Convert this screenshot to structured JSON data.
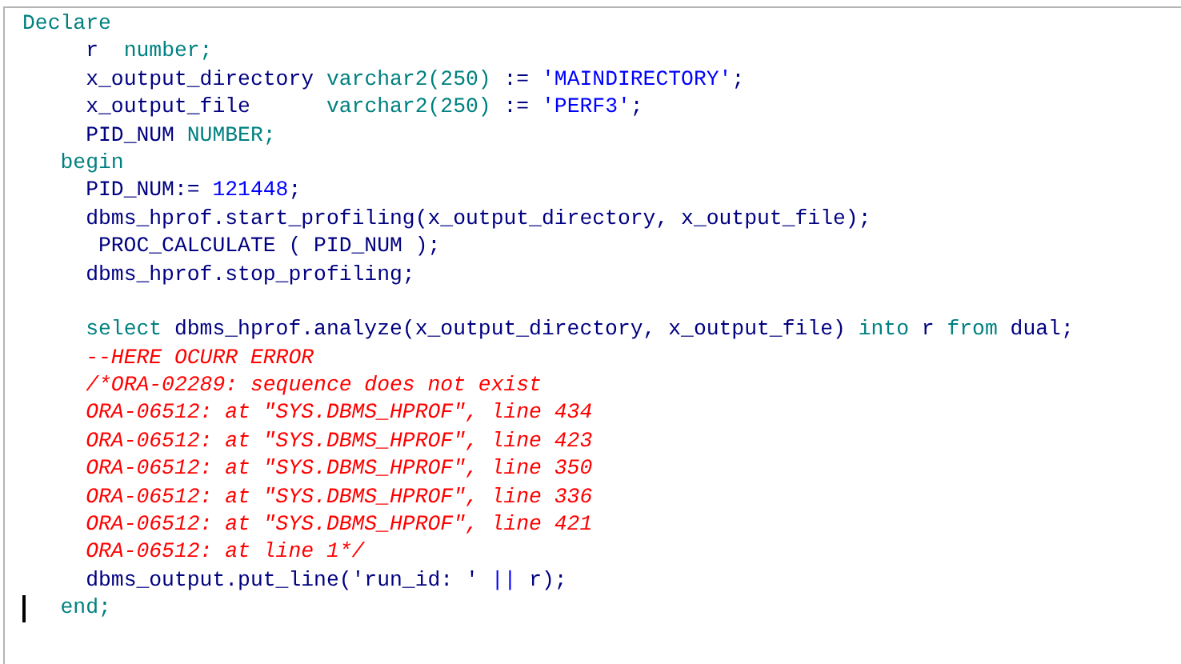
{
  "editor": {
    "lines": [
      [
        {
          "kind": "keyword",
          "text": "Declare"
        }
      ],
      [
        {
          "kind": "plain",
          "text": "     r  "
        },
        {
          "kind": "keyword",
          "text": "number;"
        }
      ],
      [
        {
          "kind": "plain",
          "text": "     x_output_directory "
        },
        {
          "kind": "keyword",
          "text": "varchar2(250)"
        },
        {
          "kind": "plain",
          "text": " := "
        },
        {
          "kind": "literal",
          "text": "'MAINDIRECTORY'"
        },
        {
          "kind": "plain",
          "text": ";"
        }
      ],
      [
        {
          "kind": "plain",
          "text": "     x_output_file      "
        },
        {
          "kind": "keyword",
          "text": "varchar2(250)"
        },
        {
          "kind": "plain",
          "text": " := "
        },
        {
          "kind": "literal",
          "text": "'PERF3'"
        },
        {
          "kind": "plain",
          "text": ";"
        }
      ],
      [
        {
          "kind": "plain",
          "text": "     PID_NUM "
        },
        {
          "kind": "keyword",
          "text": "NUMBER;"
        }
      ],
      [
        {
          "kind": "keyword",
          "text": "   begin"
        }
      ],
      [
        {
          "kind": "plain",
          "text": "     PID_NUM:= "
        },
        {
          "kind": "literal",
          "text": "121448"
        },
        {
          "kind": "plain",
          "text": ";"
        }
      ],
      [
        {
          "kind": "plain",
          "text": "     dbms_hprof.start_profiling(x_output_directory, x_output_file);"
        }
      ],
      [
        {
          "kind": "plain",
          "text": "      PROC_CALCULATE ( PID_NUM );"
        }
      ],
      [
        {
          "kind": "plain",
          "text": "     dbms_hprof.stop_profiling;"
        }
      ],
      {
        "kind": "blank"
      },
      [
        {
          "kind": "keyword",
          "text": "     select"
        },
        {
          "kind": "plain",
          "text": " dbms_hprof.analyze(x_output_directory, x_output_file) "
        },
        {
          "kind": "keyword",
          "text": "into"
        },
        {
          "kind": "plain",
          "text": " r "
        },
        {
          "kind": "keyword",
          "text": "from"
        },
        {
          "kind": "plain",
          "text": " dual;"
        }
      ],
      [
        {
          "kind": "comment",
          "text": "     --HERE OCURR ERROR"
        }
      ],
      [
        {
          "kind": "comment",
          "text": "     /*ORA-02289: sequence does not exist"
        }
      ],
      [
        {
          "kind": "comment",
          "text": "     ORA-06512: at \"SYS.DBMS_HPROF\", line 434"
        }
      ],
      [
        {
          "kind": "comment",
          "text": "     ORA-06512: at \"SYS.DBMS_HPROF\", line 423"
        }
      ],
      [
        {
          "kind": "comment",
          "text": "     ORA-06512: at \"SYS.DBMS_HPROF\", line 350"
        }
      ],
      [
        {
          "kind": "comment",
          "text": "     ORA-06512: at \"SYS.DBMS_HPROF\", line 336"
        }
      ],
      [
        {
          "kind": "comment",
          "text": "     ORA-06512: at \"SYS.DBMS_HPROF\", line 421"
        }
      ],
      [
        {
          "kind": "comment",
          "text": "     ORA-06512: at line 1*/"
        }
      ],
      [
        {
          "kind": "plain",
          "text": "     dbms_output.put_line('run_id: ' "
        },
        {
          "kind": "literal",
          "text": "||"
        },
        {
          "kind": "plain",
          "text": " r);"
        }
      ],
      [
        {
          "kind": "keyword",
          "text": "   end;"
        }
      ]
    ]
  }
}
